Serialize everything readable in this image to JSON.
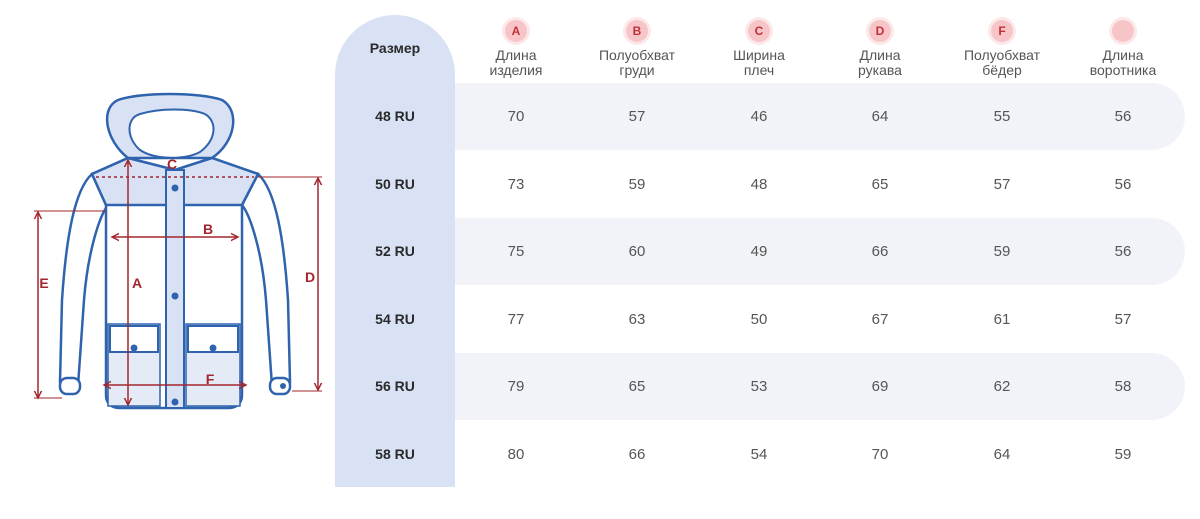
{
  "colors": {
    "outline": "#2f63ad",
    "fill": "#d8e2f4",
    "dim": "#a3262e",
    "badge": "#f7c5c8",
    "band": "#f1f3f9"
  },
  "jacket": {
    "letters": {
      "a": "A",
      "b": "B",
      "c": "C",
      "d": "D",
      "e": "E",
      "f": "F"
    }
  },
  "table": {
    "size_header": "Размер",
    "columns": [
      {
        "badge": "A",
        "label": "Длина\nизделия"
      },
      {
        "badge": "B",
        "label": "Полуобхват\nгруди"
      },
      {
        "badge": "C",
        "label": "Ширина\nплеч"
      },
      {
        "badge": "D",
        "label": "Длина\nрукава"
      },
      {
        "badge": "F",
        "label": "Полуобхват\nбёдер"
      },
      {
        "badge": "",
        "label": "Длина\nворотника"
      }
    ],
    "rows": [
      {
        "size": "48 RU",
        "values": [
          "70",
          "57",
          "46",
          "64",
          "55",
          "56"
        ]
      },
      {
        "size": "50 RU",
        "values": [
          "73",
          "59",
          "48",
          "65",
          "57",
          "56"
        ]
      },
      {
        "size": "52 RU",
        "values": [
          "75",
          "60",
          "49",
          "66",
          "59",
          "56"
        ]
      },
      {
        "size": "54 RU",
        "values": [
          "77",
          "63",
          "50",
          "67",
          "61",
          "57"
        ]
      },
      {
        "size": "56 RU",
        "values": [
          "79",
          "65",
          "53",
          "69",
          "62",
          "58"
        ]
      },
      {
        "size": "58 RU",
        "values": [
          "80",
          "66",
          "54",
          "70",
          "64",
          "59"
        ]
      }
    ]
  }
}
